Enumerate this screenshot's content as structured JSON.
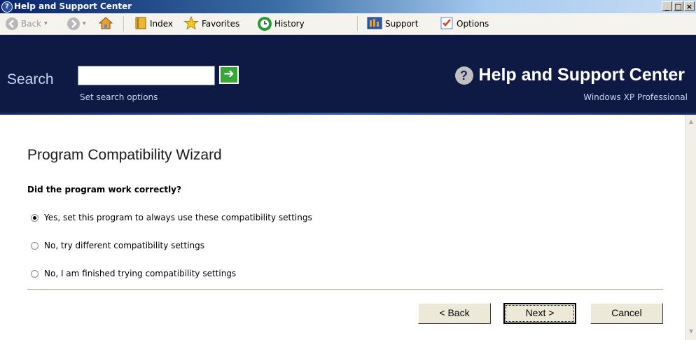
{
  "window": {
    "title": "Help and Support Center",
    "controls": {
      "minimize": "_",
      "maximize": "□",
      "close": "×"
    }
  },
  "toolbar": {
    "back": {
      "label": "Back",
      "icon": "back-arrow-icon"
    },
    "forward": {
      "icon": "forward-arrow-icon"
    },
    "home": {
      "icon": "home-icon"
    },
    "index": {
      "label": "Index",
      "icon": "book-icon"
    },
    "favorites": {
      "label": "Favorites",
      "icon": "star-icon"
    },
    "history": {
      "label": "History",
      "icon": "history-icon"
    },
    "support": {
      "label": "Support",
      "icon": "support-icon"
    },
    "options": {
      "label": "Options",
      "icon": "checklist-icon"
    }
  },
  "search": {
    "label": "Search",
    "value": "",
    "go_icon": "go-arrow-icon",
    "set_options": "Set search options",
    "header_title": "Help and Support Center",
    "header_subtitle": "Windows XP Professional"
  },
  "wizard": {
    "title": "Program Compatibility Wizard",
    "question": "Did the program work correctly?",
    "options": [
      {
        "label": "Yes, set this program to always use these compatibility settings",
        "checked": true
      },
      {
        "label": "No, try different compatibility settings",
        "checked": false
      },
      {
        "label": "No, I am finished trying compatibility settings",
        "checked": false
      }
    ],
    "buttons": {
      "back": "< Back",
      "next": "Next >",
      "cancel": "Cancel"
    }
  },
  "colors": {
    "header_bg": "#0f1a44",
    "title_gradient_start": "#0a246a",
    "go_button": "#3aa63a"
  }
}
